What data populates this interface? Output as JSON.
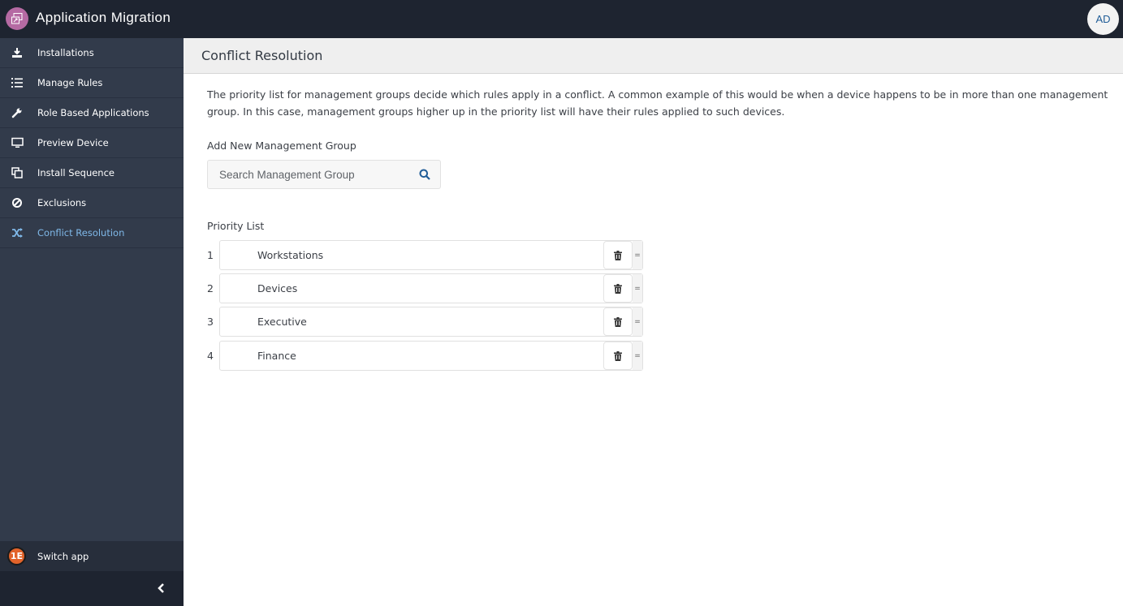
{
  "app": {
    "title": "Application Migration",
    "user_initials": "AD",
    "accent_color": "#7fb8e8"
  },
  "sidebar": {
    "items": [
      {
        "label": "Installations",
        "icon": "download-icon",
        "active": false
      },
      {
        "label": "Manage Rules",
        "icon": "ordered-list-icon",
        "active": false
      },
      {
        "label": "Role Based Applications",
        "icon": "wrench-icon",
        "active": false
      },
      {
        "label": "Preview Device",
        "icon": "monitor-icon",
        "active": false
      },
      {
        "label": "Install Sequence",
        "icon": "copy-icon",
        "active": false
      },
      {
        "label": "Exclusions",
        "icon": "ban-icon",
        "active": false
      },
      {
        "label": "Conflict Resolution",
        "icon": "shuffle-icon",
        "active": true
      }
    ],
    "switch_app_label": "Switch app",
    "switch_app_logo_text": "1E"
  },
  "page": {
    "title": "Conflict Resolution",
    "description": "The priority list for management groups decide which rules apply in a conflict. A common example of this would be when a device happens to be in more than one management group. In this case, management groups higher up in the priority list will have their rules applied to such devices.",
    "add_group_label": "Add New Management Group",
    "search_placeholder": "Search Management Group",
    "search_value": "",
    "priority_list_label": "Priority List",
    "priority_list": [
      {
        "rank": "1",
        "name": "Workstations"
      },
      {
        "rank": "2",
        "name": "Devices"
      },
      {
        "rank": "3",
        "name": "Executive"
      },
      {
        "rank": "4",
        "name": "Finance"
      }
    ],
    "drag_glyph": "="
  }
}
